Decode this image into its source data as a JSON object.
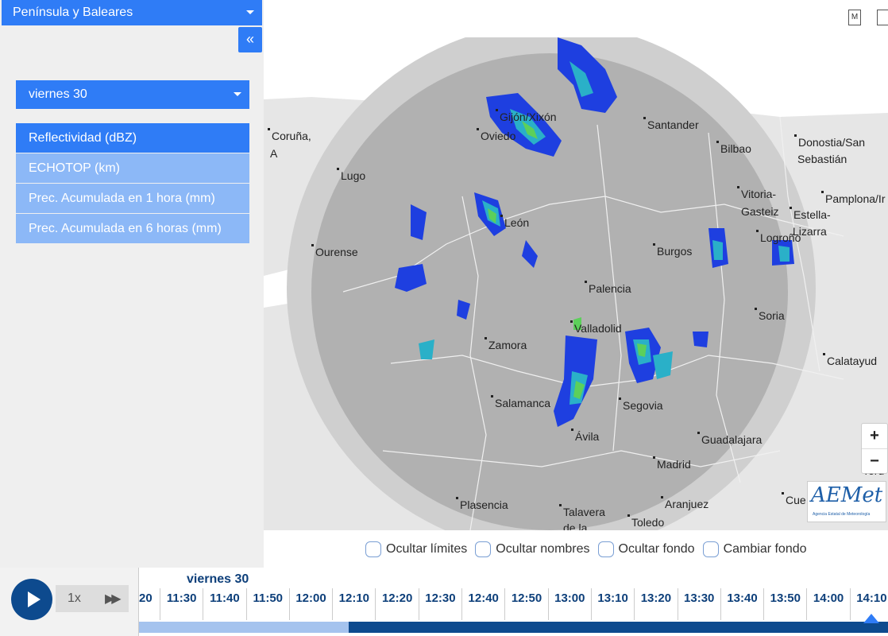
{
  "sidebar": {
    "region": "Península y Baleares",
    "collapse_icon": "«",
    "day": "viernes 30",
    "products": [
      {
        "label": "Reflectividad (dBZ)",
        "active": true
      },
      {
        "label": "ECHOTOP (km)",
        "active": false
      },
      {
        "label": "Prec. Acumulada en 1 hora (mm)",
        "active": false
      },
      {
        "label": "Prec. Acumulada en 6 horas (mm)",
        "active": false
      }
    ]
  },
  "toolbar": {
    "m_icon_label": "M",
    "icons": [
      "map-m-icon",
      "download-icon"
    ]
  },
  "map": {
    "cities": [
      {
        "name": "Coruña,"
      },
      {
        "name": "A"
      },
      {
        "name": "Lugo"
      },
      {
        "name": "Gijón/Xixón"
      },
      {
        "name": "Oviedo"
      },
      {
        "name": "Santander"
      },
      {
        "name": "Bilbao"
      },
      {
        "name": "Donostia/San"
      },
      {
        "name": "Sebastián"
      },
      {
        "name": "Vitoria-"
      },
      {
        "name": "Gasteiz"
      },
      {
        "name": "Pamplona/Ir"
      },
      {
        "name": "Estella-"
      },
      {
        "name": "Lizarra"
      },
      {
        "name": "Logroño"
      },
      {
        "name": "León"
      },
      {
        "name": "Ourense"
      },
      {
        "name": "Burgos"
      },
      {
        "name": "Palencia"
      },
      {
        "name": "Soria"
      },
      {
        "name": "Valladolid"
      },
      {
        "name": "Zamora"
      },
      {
        "name": "Calatayud"
      },
      {
        "name": "Salamanca"
      },
      {
        "name": "Segovia"
      },
      {
        "name": "Ávila"
      },
      {
        "name": "Guadalajara"
      },
      {
        "name": "Madrid"
      },
      {
        "name": "Plasencia"
      },
      {
        "name": "Talavera"
      },
      {
        "name": "de la"
      },
      {
        "name": "Toledo"
      },
      {
        "name": "Aranjuez"
      },
      {
        "name": "Cue"
      },
      {
        "name": "Teru"
      }
    ],
    "zoom_in": "+",
    "zoom_out": "−",
    "logo_text": "AEMet",
    "logo_sub": "Agencia Estatal de Meteorología"
  },
  "options": [
    {
      "label": "Ocultar límites"
    },
    {
      "label": "Ocultar nombres"
    },
    {
      "label": "Ocultar fondo"
    },
    {
      "label": "Cambiar fondo"
    }
  ],
  "timeline": {
    "speed": "1x",
    "ffwd": "▶▶",
    "day": "viernes 30",
    "times": [
      "20",
      "11:30",
      "11:40",
      "11:50",
      "12:00",
      "12:10",
      "12:20",
      "12:30",
      "12:40",
      "12:50",
      "13:00",
      "13:10",
      "13:20",
      "13:30",
      "13:40",
      "13:50",
      "14:00",
      "14:10"
    ],
    "progress_fraction": 0.28
  }
}
